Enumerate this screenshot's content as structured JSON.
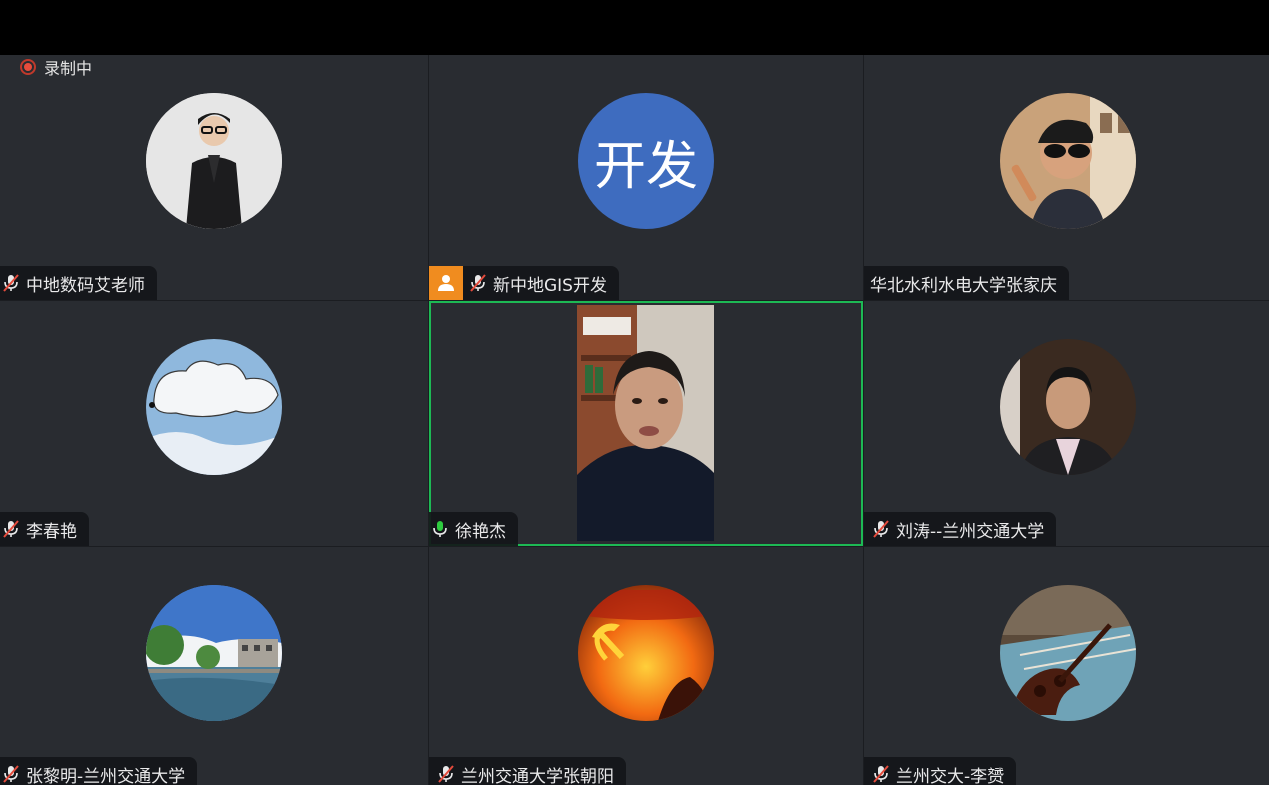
{
  "recording": {
    "label": "录制中"
  },
  "participants": [
    {
      "name": "中地数码艾老师",
      "mic": "muted",
      "avatar": "photo-man-black-suit"
    },
    {
      "name": "新中地GIS开发",
      "mic": "muted",
      "avatar_text": "开发",
      "host": true
    },
    {
      "name": "华北水利水电大学张家庆",
      "mic": "none",
      "avatar": "photo-sunglasses"
    },
    {
      "name": "李春艳",
      "mic": "muted",
      "avatar": "photo-cloud-sky"
    },
    {
      "name": "徐艳杰",
      "mic": "active",
      "video": true,
      "speaking": true
    },
    {
      "name": "刘涛--兰州交通大学",
      "mic": "muted",
      "avatar": "photo-man-portrait"
    },
    {
      "name": "张黎明-兰州交通大学",
      "mic": "muted",
      "avatar": "photo-lake-trees"
    },
    {
      "name": "兰州交通大学张朝阳",
      "mic": "muted",
      "avatar": "photo-party-flag"
    },
    {
      "name": "兰州交大-李赟",
      "mic": "muted",
      "avatar": "photo-violin"
    }
  ],
  "colors": {
    "tile_bg": "#292c31",
    "active_border": "#1db954",
    "host_badge": "#f08c1f",
    "text_avatar_bg": "#3e6cbf",
    "muted_mic": "#e54b3c",
    "active_mic": "#2ecc40"
  }
}
